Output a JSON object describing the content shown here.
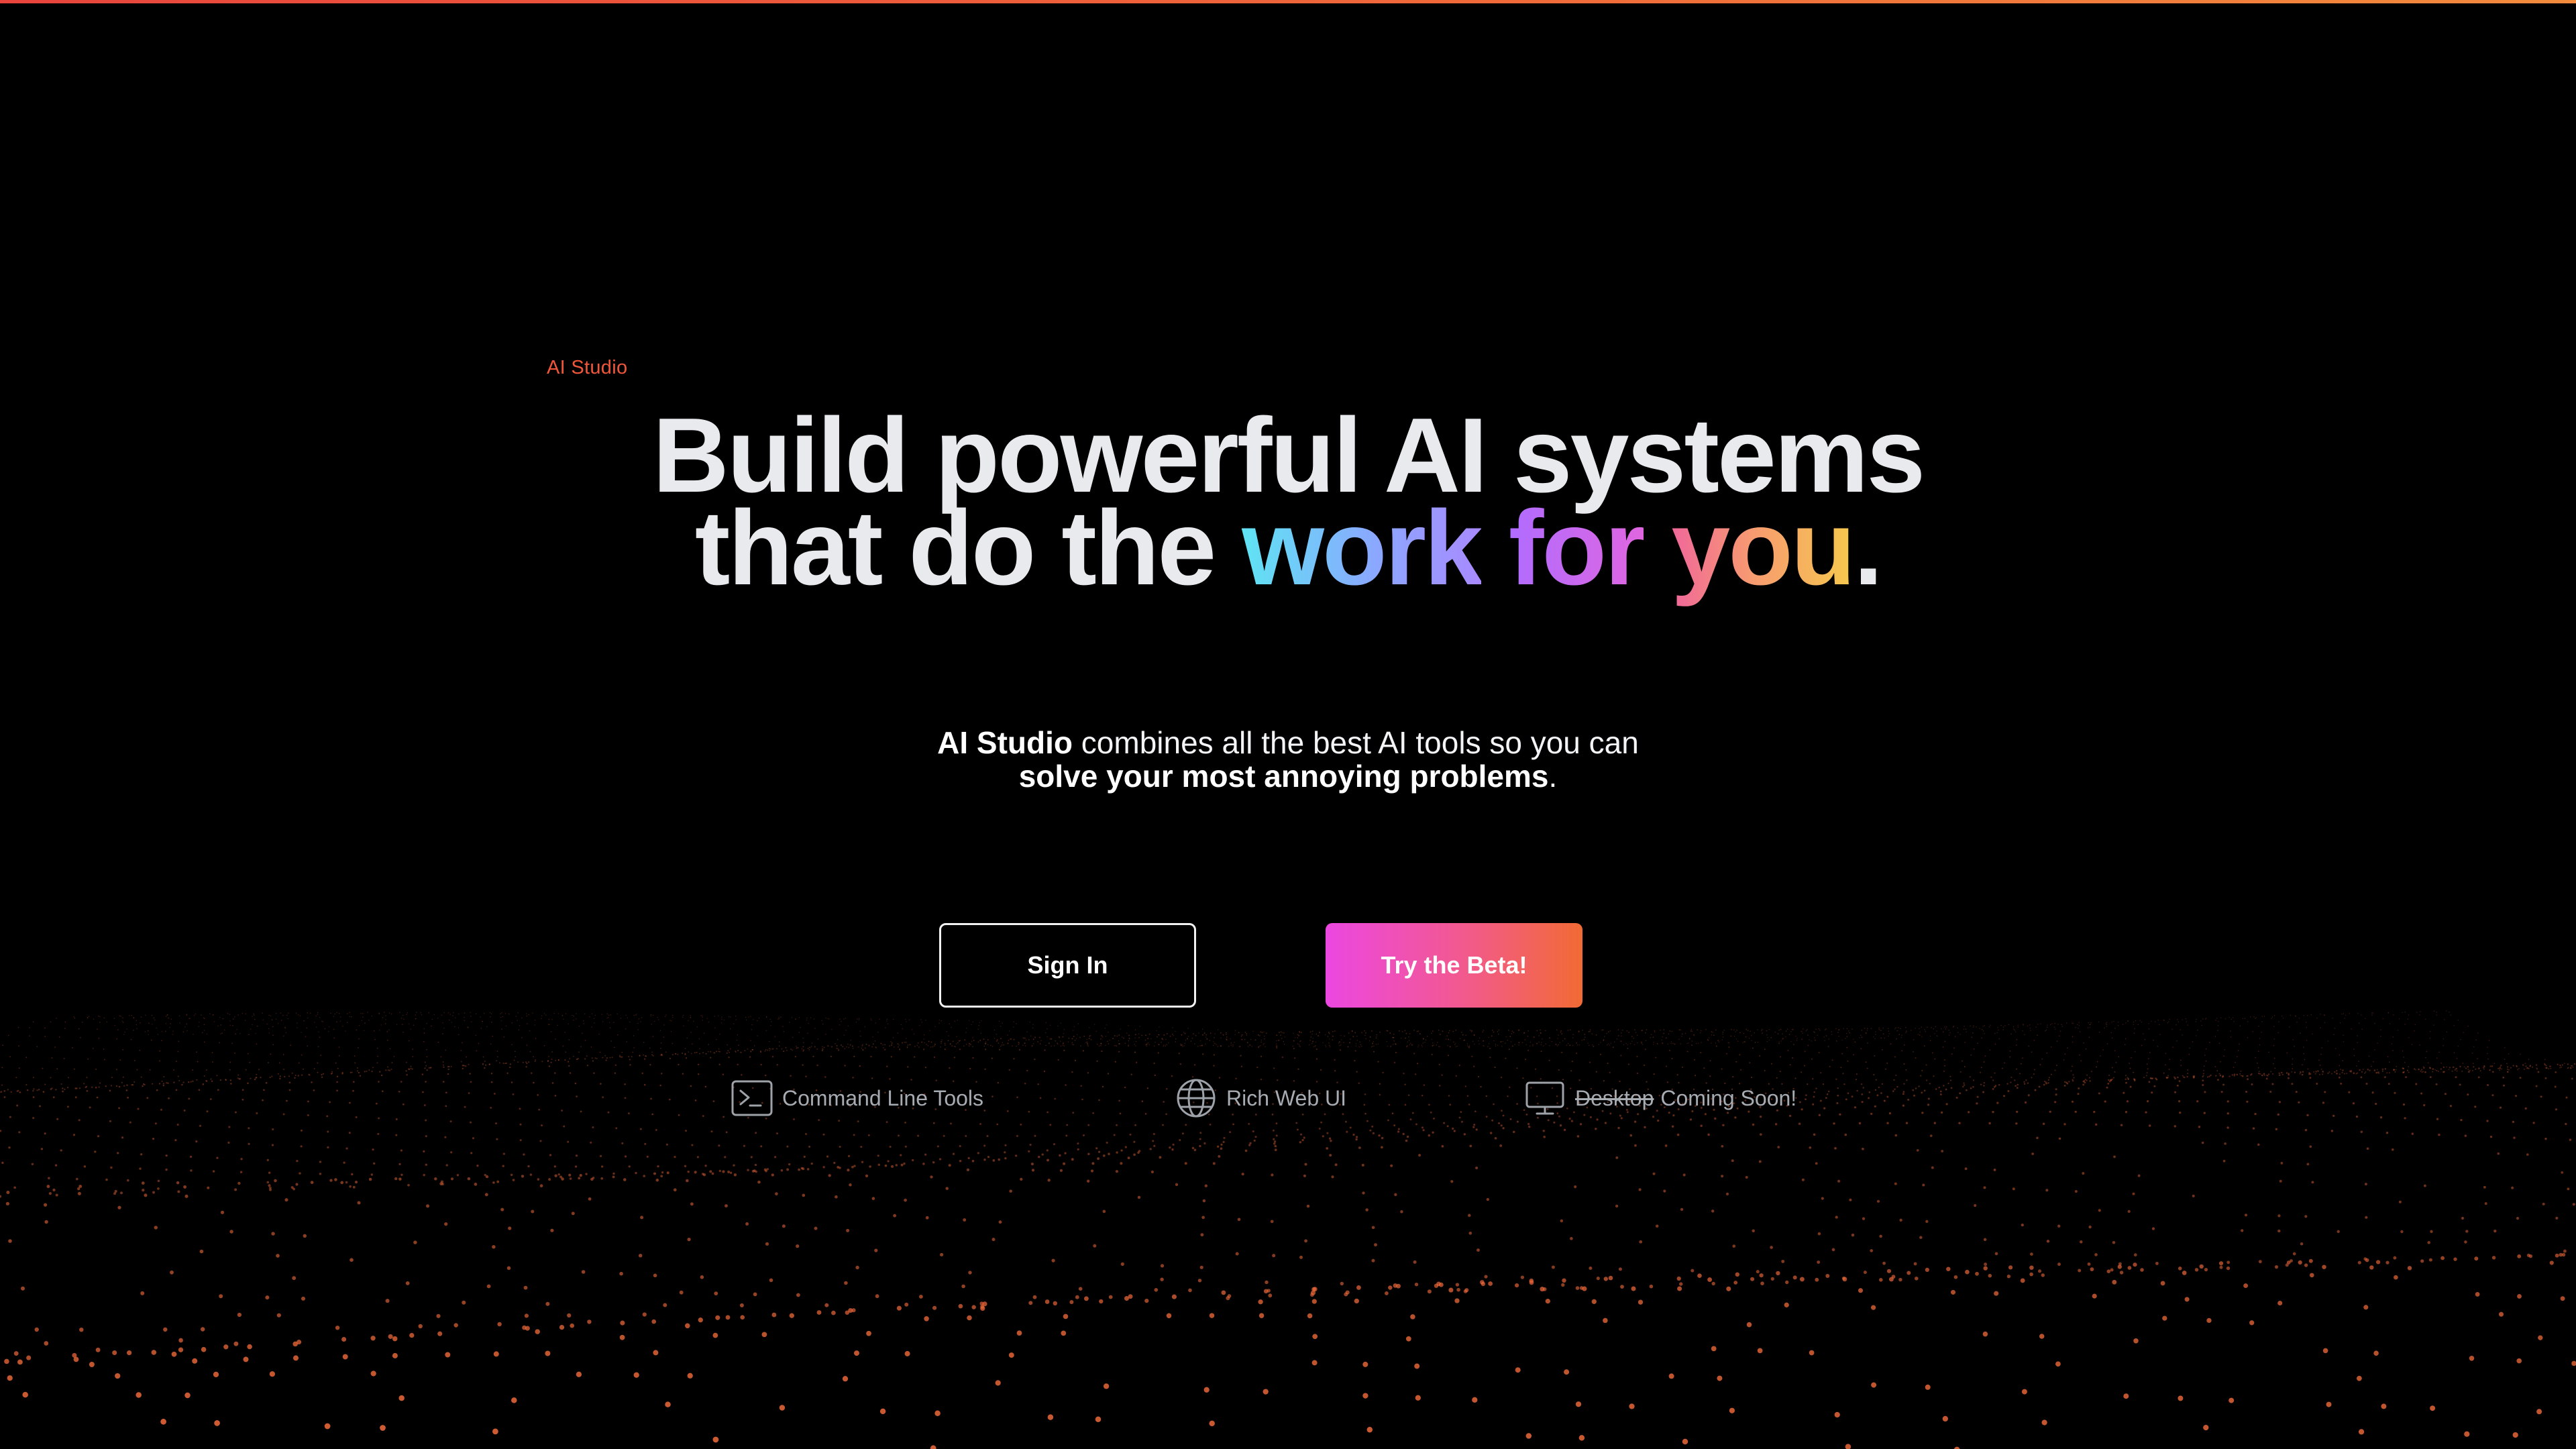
{
  "brand": {
    "label": "AI Studio"
  },
  "hero": {
    "line1": "Build powerful AI systems",
    "line2_prefix": "that do the ",
    "word_work": "work",
    "word_for": "for",
    "word_you": "you",
    "line2_suffix": "."
  },
  "subtitle": {
    "bold1": "AI Studio",
    "text1": " combines all the best AI tools so you can",
    "bold2": "solve your most annoying problems",
    "text2": "."
  },
  "buttons": {
    "signin_label": "Sign In",
    "beta_label": "Try the Beta!"
  },
  "features": [
    {
      "icon": "terminal-icon",
      "label": "Command Line Tools"
    },
    {
      "icon": "globe-icon",
      "label": "Rich Web UI"
    },
    {
      "icon": "monitor-icon",
      "strike_label": "Desktop",
      "label": "Coming Soon!"
    }
  ],
  "colors": {
    "background": "#000000",
    "brand_accent": "#f0573a",
    "particle": "#f06a3a",
    "beta_gradient_start": "#ec47e2",
    "beta_gradient_end": "#f26a34"
  }
}
